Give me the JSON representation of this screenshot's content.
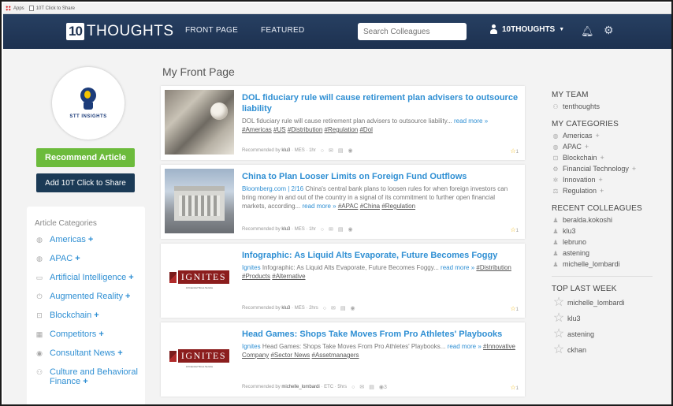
{
  "browser": {
    "bookmarks": [
      "Apps",
      "10T Click to Share"
    ]
  },
  "header": {
    "logo_num": "10",
    "logo_word": "THOUGHTS",
    "nav": [
      "FRONT PAGE",
      "FEATURED"
    ],
    "search_placeholder": "Search Colleagues",
    "user": "10THOUGHTS"
  },
  "sidebar": {
    "badge_text": "STT INSIGHTS",
    "recommend_label": "Recommend Article",
    "share_label": "Add 10T Click to Share",
    "categories_title": "Article Categories",
    "categories": [
      {
        "label": "Americas",
        "icon": "globe-icon"
      },
      {
        "label": "APAC",
        "icon": "globe-icon"
      },
      {
        "label": "Artificial Intelligence",
        "icon": "laptop-icon"
      },
      {
        "label": "Augmented Reality",
        "icon": "power-icon"
      },
      {
        "label": "Blockchain",
        "icon": "blockchain-icon"
      },
      {
        "label": "Competitors",
        "icon": "building-icon"
      },
      {
        "label": "Consultant News",
        "icon": "pin-icon"
      },
      {
        "label": "Culture and Behavioral Finance",
        "icon": "users-icon"
      }
    ]
  },
  "main": {
    "title": "My Front Page",
    "articles": [
      {
        "title": "DOL fiduciary rule will cause retirement plan advisers to outsource liability",
        "source": "",
        "summary": "DOL fiduciary rule will cause retirement plan advisers to outsource liability...",
        "more": "read more »",
        "tags": [
          "#Americas",
          "#US",
          "#Distribution",
          "#Regulation",
          "#Dol"
        ],
        "recommended_by": "klu3",
        "meta": "MES · 1hr",
        "count": "",
        "stars": "1"
      },
      {
        "title": "China to Plan Looser Limits on Foreign Fund Outflows",
        "source": "Bloomberg.com | 2/16",
        "summary": "China's central bank plans to loosen rules for when foreign investors can bring money in and out of the country in a signal of its commitment to further open financial markets, according...",
        "more": "read more »",
        "tags": [
          "#APAC",
          "#China",
          "#Regulation"
        ],
        "recommended_by": "klu3",
        "meta": "MES · 1hr",
        "count": "",
        "stars": "1"
      },
      {
        "title": "Infographic: As Liquid Alts Evaporate, Future Becomes Foggy",
        "source": "Ignites",
        "summary": "Infographic: As Liquid Alts Evaporate, Future Becomes Foggy...",
        "more": "read more »",
        "tags": [
          "#Distribution",
          "#Products",
          "#Alternative"
        ],
        "recommended_by": "klu3",
        "meta": "MES · 2hrs",
        "count": "",
        "stars": "1"
      },
      {
        "title": "Head Games: Shops Take Moves From Pro Athletes' Playbooks",
        "source": "Ignites",
        "summary": "Head Games: Shops Take Moves From Pro Athletes' Playbooks...",
        "more": "read more »",
        "tags": [
          "#Innovative Company",
          "#Sector News",
          "#Assetmanagers"
        ],
        "recommended_by": "michelle_lombardi",
        "meta": "ETC · 5hrs",
        "count": "3",
        "stars": "1"
      }
    ],
    "footer_prefix": "Recommended by",
    "ignites_word": "IGNITES",
    "ignites_sub": "A Financial Times Service"
  },
  "right": {
    "my_team_title": "MY TEAM",
    "team": [
      "tenthoughts"
    ],
    "my_categories_title": "MY CATEGORIES",
    "categories": [
      "Americas",
      "APAC",
      "Blockchain",
      "Financial Technology",
      "Innovation",
      "Regulation"
    ],
    "recent_title": "RECENT COLLEAGUES",
    "recent": [
      "beralda.kokoshi",
      "klu3",
      "lebruno",
      "astening",
      "michelle_lombardi"
    ],
    "top_title": "TOP LAST WEEK",
    "top": [
      "michelle_lombardi",
      "klu3",
      "astening",
      "ckhan"
    ]
  }
}
